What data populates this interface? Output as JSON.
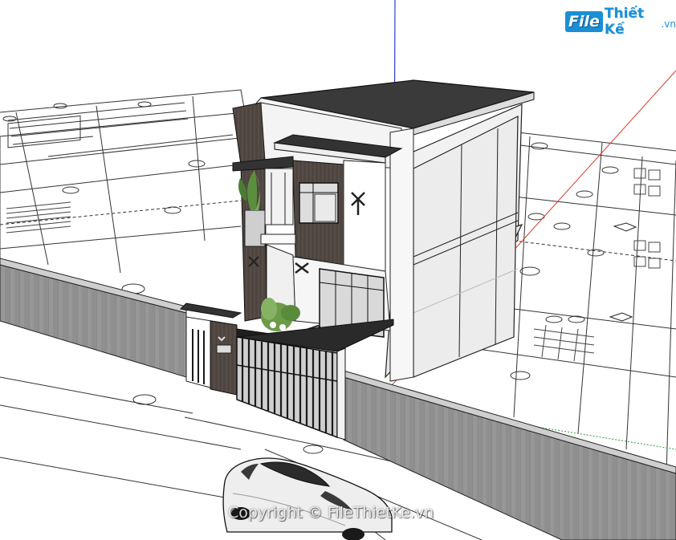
{
  "logo": {
    "file": "File",
    "name": "Thiết Kế",
    "tld": ".vn"
  },
  "watermark": "Copyright © FileThietKe.vn",
  "colors": {
    "axis_blue": "#2c3fd6",
    "axis_red": "#d93a2b",
    "axis_green": "#2f9a3a",
    "wall": "#8f8f8f",
    "roof": "#3a3a3a",
    "wood": "#4e4540",
    "logo_blue": "#1a8fd6"
  }
}
